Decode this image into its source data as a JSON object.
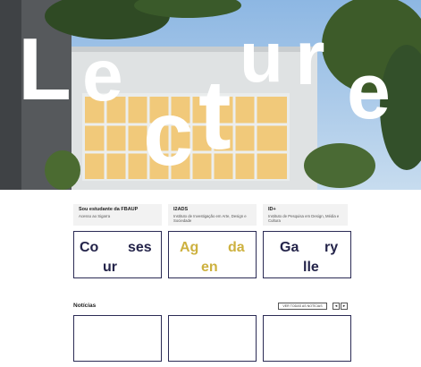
{
  "hero": {
    "letters": [
      "L",
      "e",
      "c",
      "t",
      "u",
      "r",
      "e"
    ]
  },
  "info_cards": [
    {
      "title": "Sou estudante da FBAUP",
      "subtitle": "Acesso ao Sigarra"
    },
    {
      "title": "I2ADS",
      "subtitle": "Instituto de Investigação em Arte, Design e Sociedade"
    },
    {
      "title": "ID+",
      "subtitle": "Instituto de Pesquisa em Design, Média e Cultura"
    }
  ],
  "sections": {
    "courses": [
      "Co",
      "ses",
      "ur"
    ],
    "agenda": [
      "Ag",
      "da",
      "en"
    ],
    "gallery": [
      "Ga",
      "ry",
      "lle"
    ]
  },
  "news": {
    "title": "Notícias",
    "see_all": "VER TODAS AS NOTÍCIAS",
    "prev": "◂",
    "next": "▸"
  },
  "colors": {
    "navy": "#24244a",
    "gold": "#cdb13f",
    "border": "#2b2b55"
  }
}
